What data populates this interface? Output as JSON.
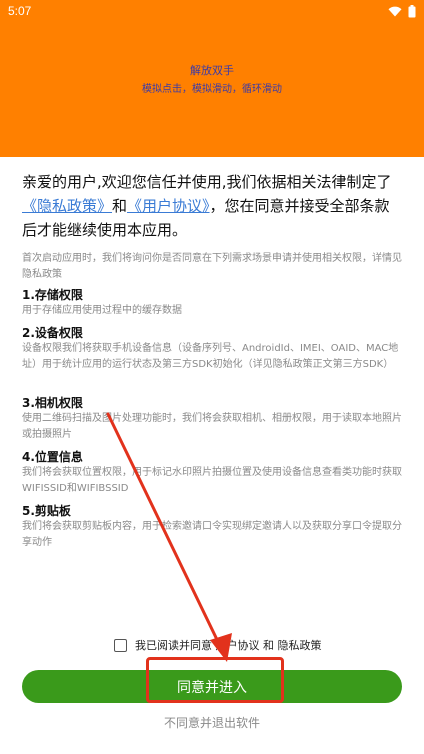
{
  "status_bar": {
    "time": "5:07",
    "icons": [
      "wifi-icon",
      "battery-icon"
    ]
  },
  "header": {
    "title": "解放双手",
    "subtitle": "模拟点击，模拟滑动，循环滑动"
  },
  "intro": {
    "part1": "亲爱的用户,欢迎您信任并使用,我们依据相关法律制定了",
    "privacy_link": "《隐私政策》",
    "and": "和",
    "agreement_link": "《用户协议》",
    "part2": "，您在同意并接受全部条款后才能继续使用本应用。"
  },
  "notice": "首次启动应用时，我们将询问你是否同意在下列需求场景申请并使用相关权限，详情见隐私政策",
  "permissions": [
    {
      "title": "1.存储权限",
      "desc": "用于存储应用使用过程中的缓存数据"
    },
    {
      "title": "2.设备权限",
      "desc": "设备权限我们将获取手机设备信息（设备序列号、AndroidId、IMEI、OAID、MAC地址）用于统计应用的运行状态及第三方SDK初始化（详见隐私政策正文第三方SDK）"
    },
    {
      "title": "3.相机权限",
      "desc": "使用二维码扫描及图片处理功能时，我们将会获取相机、相册权限，用于读取本地照片或拍摄照片"
    },
    {
      "title": "4.位置信息",
      "desc": "我们将会获取位置权限，用于标记水印照片拍摄位置及使用设备信息查看类功能时获取WIFISSID和WIFIBSSID"
    },
    {
      "title": "5.剪贴板",
      "desc": "我们将会获取剪贴板内容，用于检索邀请口令实现绑定邀请人以及获取分享口令提取分享动作"
    }
  ],
  "agree_checkbox_label": "我已阅读并同意 用户协议 和 隐私政策",
  "buttons": {
    "enter": "同意并进入",
    "exit": "不同意并退出软件"
  },
  "colors": {
    "header": "#ff8000",
    "accent_green": "#3a9a1b",
    "link_blue": "#3a7bd5",
    "annotation_red": "#e2321c"
  }
}
